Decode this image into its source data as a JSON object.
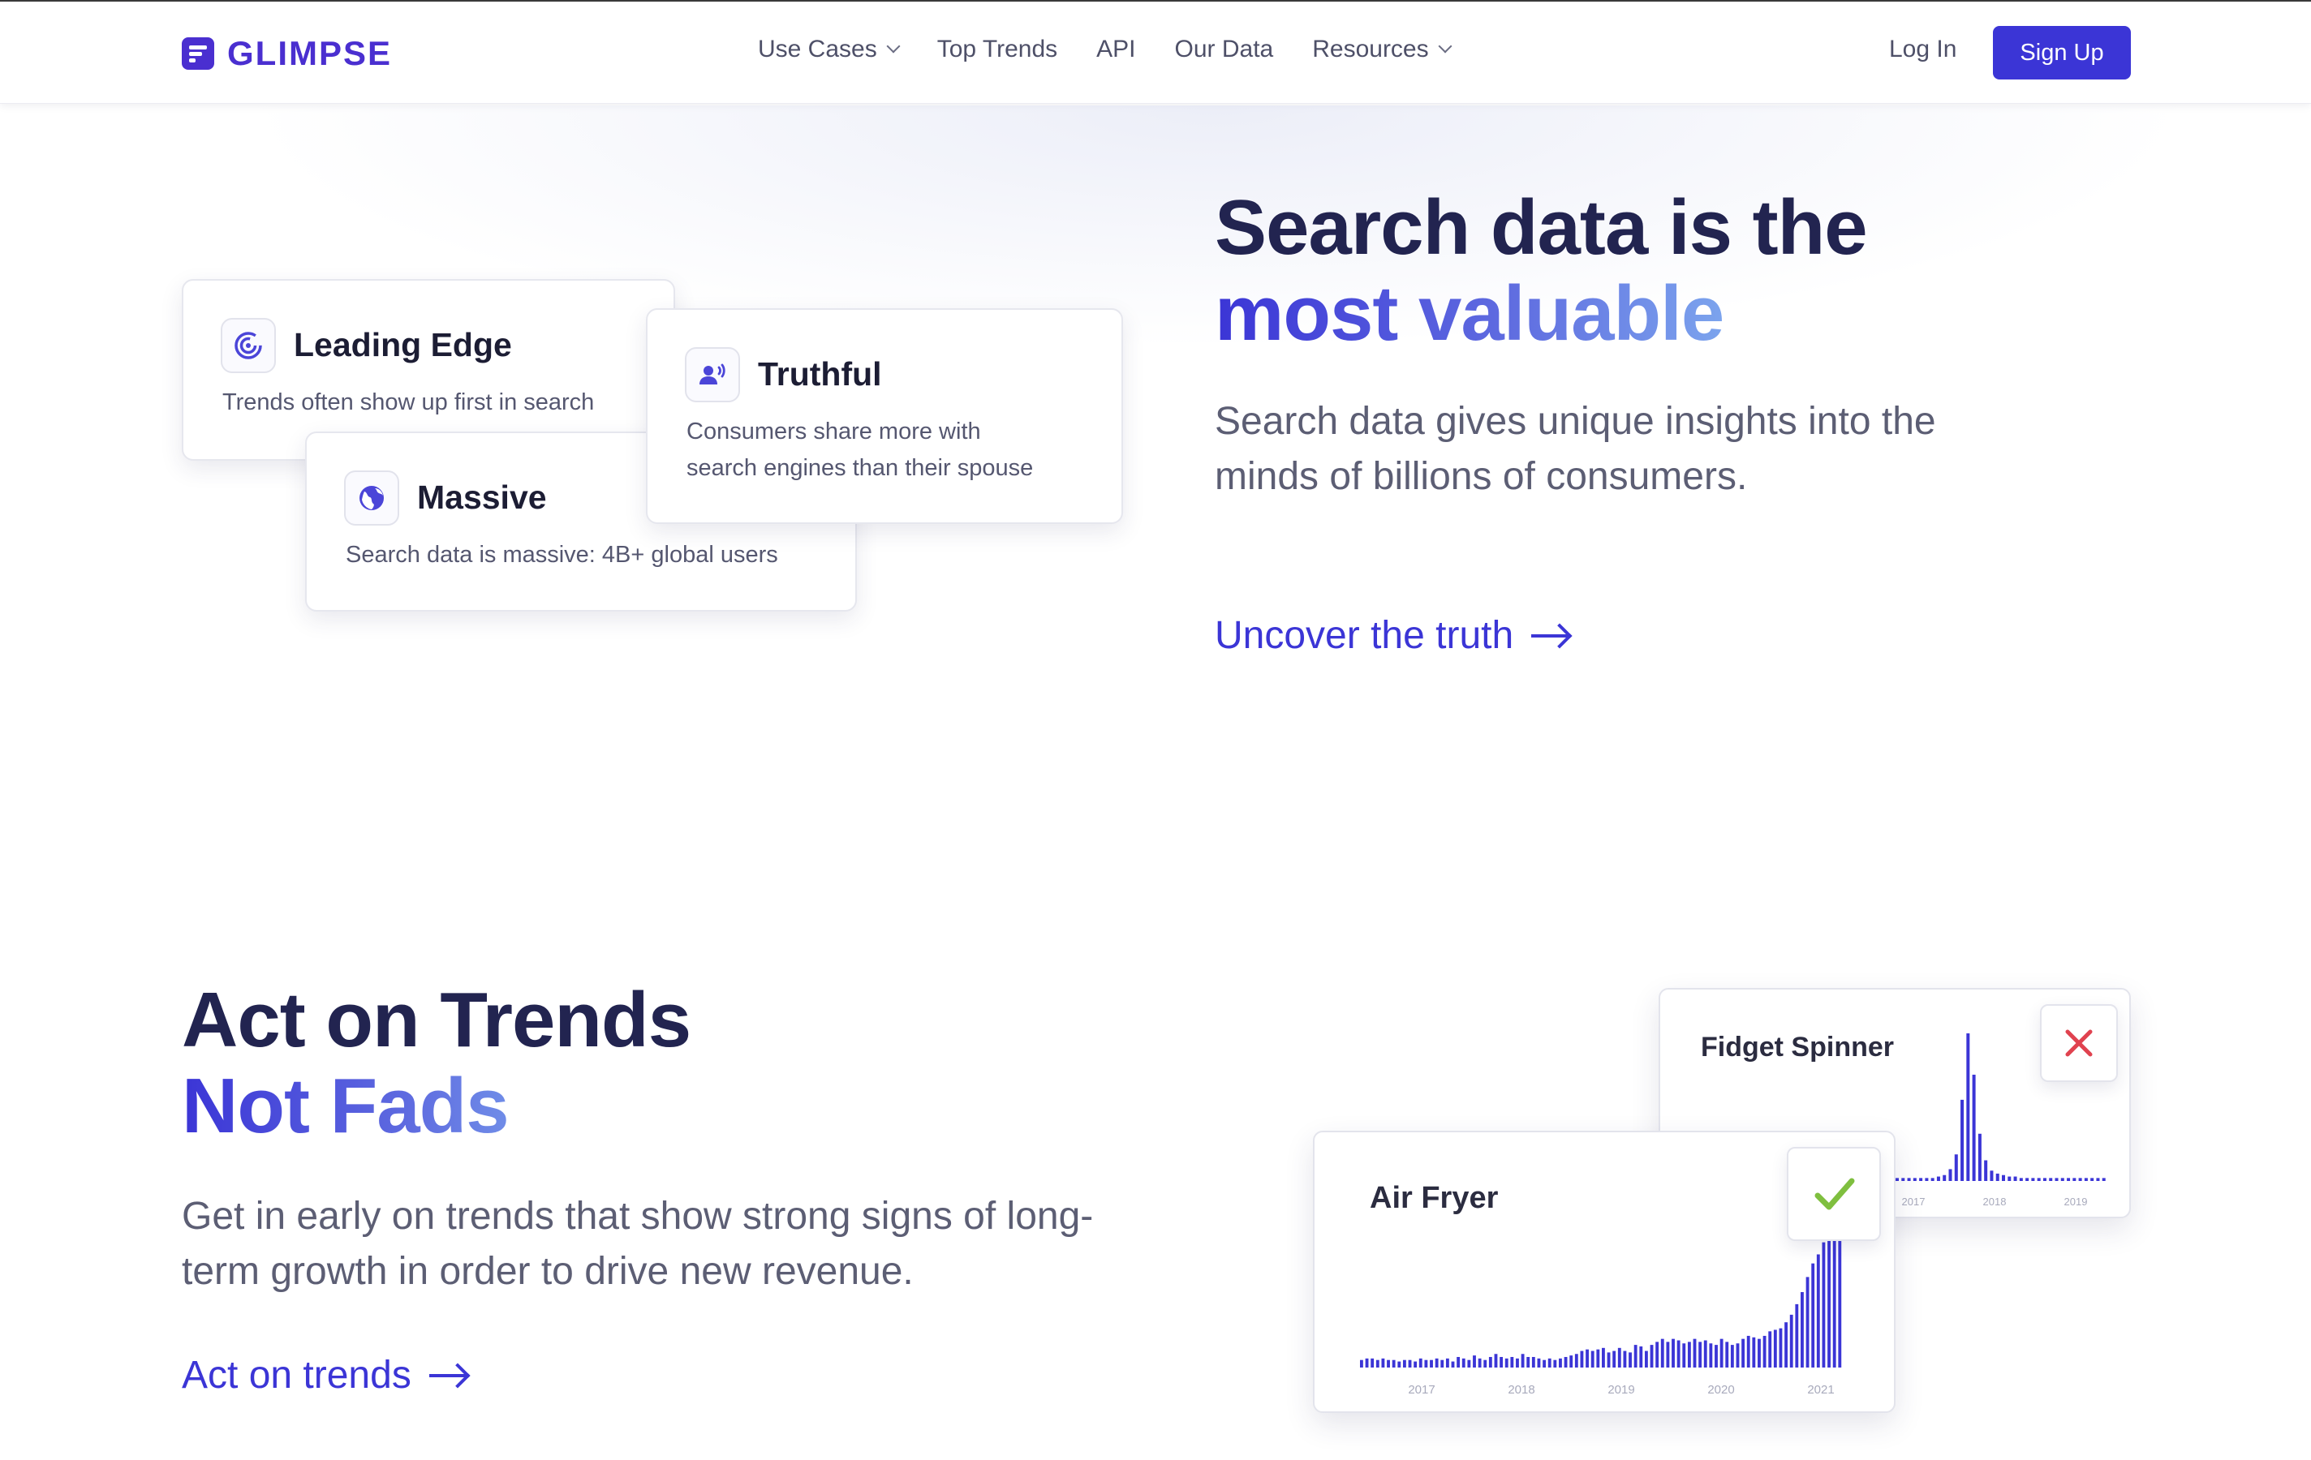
{
  "brand": {
    "name": "GLIMPSE",
    "accent": "#3b35d6",
    "logo_color": "#4a2fd0"
  },
  "nav": {
    "items": [
      {
        "label": "Use Cases",
        "has_dropdown": true
      },
      {
        "label": "Top Trends",
        "has_dropdown": false
      },
      {
        "label": "API",
        "has_dropdown": false
      },
      {
        "label": "Our Data",
        "has_dropdown": false
      },
      {
        "label": "Resources",
        "has_dropdown": true
      }
    ],
    "login_label": "Log In",
    "signup_label": "Sign Up"
  },
  "section1": {
    "title_line1": "Search data is the",
    "title_line2": "most valuable",
    "description": "Search data gives unique insights into the minds of billions of consumers.",
    "cta_label": "Uncover the truth",
    "cards": [
      {
        "icon": "radar-icon",
        "title": "Leading Edge",
        "description": "Trends often show up first in search"
      },
      {
        "icon": "globe-icon",
        "title": "Massive",
        "description": "Search data is massive: 4B+ global users"
      },
      {
        "icon": "speaking-person-icon",
        "title": "Truthful",
        "description_line1": "Consumers share more with",
        "description_line2": "search engines than their spouse"
      }
    ]
  },
  "section2": {
    "title_line1": "Act on Trends",
    "title_line2": "Not Fads",
    "description": "Get in early on trends that show strong signs of long-term growth in order to drive new revenue.",
    "cta_label": "Act on trends"
  },
  "chart_data": [
    {
      "type": "bar",
      "title": "Fidget Spinner",
      "status": "fad",
      "status_icon": "x-icon",
      "status_color": "#e0424f",
      "bar_color": "#3b35d6",
      "x_ticks": [
        "2017",
        "2018",
        "2019"
      ],
      "values": [
        2,
        2,
        2,
        2,
        2,
        2,
        2,
        3,
        4,
        8,
        18,
        55,
        100,
        72,
        32,
        14,
        7,
        5,
        4,
        3,
        3,
        2,
        2,
        2,
        2,
        2,
        2,
        2,
        2,
        2,
        2,
        2,
        2,
        2,
        2,
        2
      ]
    },
    {
      "type": "bar",
      "title": "Air Fryer",
      "status": "trend",
      "status_icon": "check-icon",
      "status_color": "#7fbf3f",
      "bar_color": "#3b35d6",
      "x_ticks": [
        "2017",
        "2018",
        "2019",
        "2020",
        "2021"
      ],
      "values": [
        5,
        6,
        6,
        5,
        6,
        5,
        5,
        4,
        5,
        5,
        4,
        6,
        5,
        5,
        6,
        5,
        6,
        4,
        7,
        6,
        5,
        8,
        6,
        5,
        7,
        9,
        7,
        6,
        7,
        6,
        9,
        7,
        7,
        6,
        5,
        6,
        5,
        6,
        7,
        8,
        9,
        11,
        12,
        11,
        12,
        13,
        10,
        11,
        13,
        11,
        10,
        15,
        14,
        11,
        15,
        17,
        19,
        17,
        19,
        18,
        16,
        17,
        19,
        17,
        18,
        16,
        15,
        19,
        17,
        15,
        16,
        19,
        21,
        20,
        19,
        21,
        24,
        25,
        26,
        30,
        35,
        42,
        50,
        60,
        69,
        75,
        83,
        93,
        100,
        100
      ]
    }
  ]
}
